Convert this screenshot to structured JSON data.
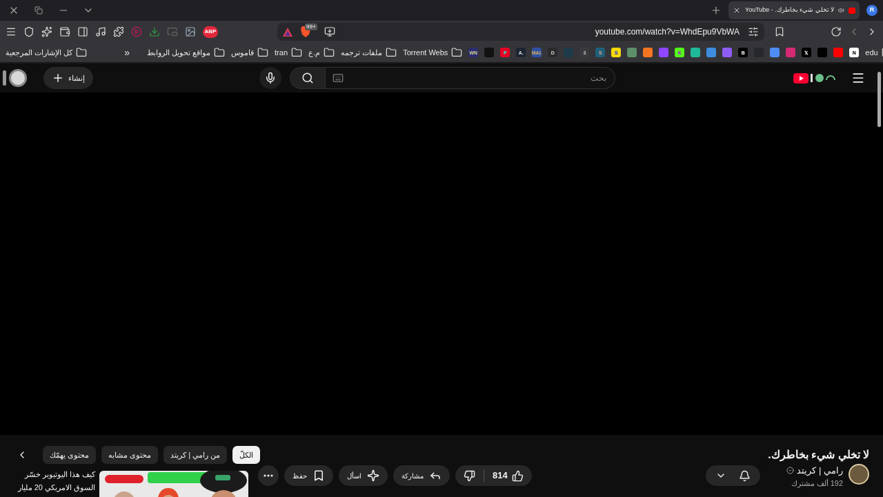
{
  "tab": {
    "title": "لا تخلي شيء بخاطرك. - YouTube",
    "selected": true
  },
  "profile": {
    "initial": "R"
  },
  "toolbar": {
    "abp_label": "ABP",
    "badge": "99+"
  },
  "address_bar": {
    "url": "youtube.com/watch?v=WhdEpu9VbWA"
  },
  "all_bookmarks": {
    "label": "كل الإشارات المرجعية"
  },
  "overflow": {
    "label": "»"
  },
  "bookmarks": [
    {
      "kind": "folder",
      "label": "edu"
    },
    {
      "kind": "site",
      "glyph": "N",
      "color": "#ffffff"
    },
    {
      "kind": "site",
      "color": "#ff0000"
    },
    {
      "kind": "site",
      "color": "#010101"
    },
    {
      "kind": "site",
      "glyph": "𝕏",
      "color": "#000000"
    },
    {
      "kind": "site",
      "color": "#d62976"
    },
    {
      "kind": "site",
      "color": "#4f8df5"
    },
    {
      "kind": "site",
      "color": "#26282c"
    },
    {
      "kind": "site",
      "glyph": "B",
      "color": "#000000"
    },
    {
      "kind": "site",
      "color": "#8f5cf5"
    },
    {
      "kind": "site",
      "color": "#3e8de0"
    },
    {
      "kind": "site",
      "color": "#1fb89a"
    },
    {
      "kind": "site",
      "glyph": "K",
      "color": "#53fc18"
    },
    {
      "kind": "site",
      "color": "#9146ff"
    },
    {
      "kind": "site",
      "color": "#f47521"
    },
    {
      "kind": "site",
      "color": "#5c8f6a"
    },
    {
      "kind": "site",
      "glyph": "S",
      "color": "#f5d90a"
    },
    {
      "kind": "site",
      "glyph": "S",
      "color": "#1f5f7a"
    },
    {
      "kind": "site",
      "glyph": "3",
      "color": "#3a3a3e"
    },
    {
      "kind": "site",
      "color": "#1d3b4a"
    },
    {
      "kind": "site",
      "glyph": "D",
      "color": "#2a2a2a"
    },
    {
      "kind": "site",
      "glyph": "MAL",
      "color": "#2e51a2"
    },
    {
      "kind": "site",
      "glyph": "A.",
      "color": "#1b2433"
    },
    {
      "kind": "site",
      "glyph": "P",
      "color": "#e60023"
    },
    {
      "kind": "site",
      "color": "#111111"
    },
    {
      "kind": "site",
      "glyph": "WN",
      "color": "#2b2d6e"
    },
    {
      "kind": "folder",
      "label": "Torrent Webs"
    },
    {
      "kind": "folder",
      "label": "ملفات ترجمه"
    },
    {
      "kind": "folder",
      "label": "م.ع"
    },
    {
      "kind": "folder",
      "label": "tran"
    },
    {
      "kind": "folder",
      "label": "قاموس"
    },
    {
      "kind": "folder",
      "label": "مواقع تحويل الروابط"
    }
  ],
  "youtube": {
    "create_label": "إنشاء",
    "search_placeholder": "بحث",
    "video_title": "لا تخلي شيء بخاطرك.",
    "channel": {
      "name": "رامي | كريتد",
      "verified": true,
      "subscribers": "192 ألف مشترك"
    },
    "like_count": "814",
    "actions": [
      {
        "kind": "share",
        "label": "مشاركة"
      },
      {
        "kind": "ask",
        "label": "اسأل"
      },
      {
        "kind": "save",
        "label": "حفظ"
      }
    ],
    "chips": [
      {
        "label": "الكلّ",
        "selected": true
      },
      {
        "label": "من رامي | كريتد",
        "selected": false
      },
      {
        "label": "محتوى مشابه",
        "selected": false
      },
      {
        "label": "محتوى يهمّك",
        "selected": false
      }
    ],
    "recommended": {
      "title": "كيف هذا اليوتيوبر خسّر السوق الامريكي 20 مليار",
      "kind": "picture"
    }
  }
}
